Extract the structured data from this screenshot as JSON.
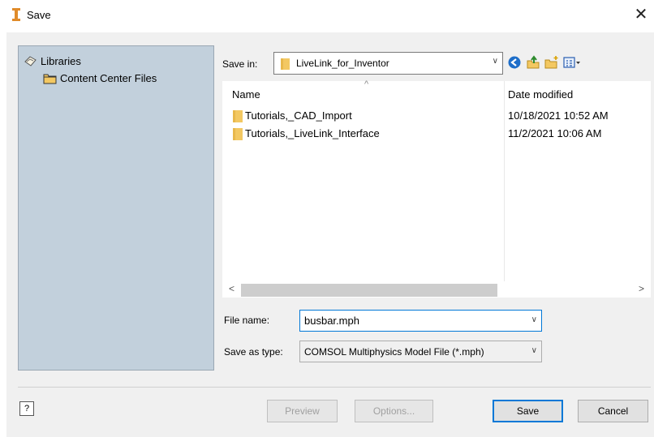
{
  "window": {
    "title": "Save",
    "close": "✕"
  },
  "places": {
    "items": [
      {
        "label": "Libraries",
        "icon": "libraries-icon"
      },
      {
        "label": "Content Center Files",
        "icon": "folder-icon"
      }
    ]
  },
  "save_in": {
    "label": "Save in:",
    "value": "LiveLink_for_Inventor"
  },
  "toolbar": {
    "icons": [
      "back-icon",
      "up-folder-icon",
      "new-folder-icon",
      "view-menu-icon"
    ]
  },
  "file_list": {
    "columns": {
      "name": "Name",
      "date": "Date modified"
    },
    "rows": [
      {
        "name": "Tutorials,_CAD_Import",
        "date": "10/18/2021 10:52 AM"
      },
      {
        "name": "Tutorials,_LiveLink_Interface",
        "date": "11/2/2021 10:06 AM"
      }
    ]
  },
  "file_name": {
    "label": "File name:",
    "value": "busbar.mph"
  },
  "save_as_type": {
    "label": "Save as type:",
    "value": "COMSOL Multiphysics Model File (*.mph)"
  },
  "buttons": {
    "preview": "Preview",
    "options": "Options...",
    "save": "Save",
    "cancel": "Cancel"
  },
  "colors": {
    "accent": "#0078d7",
    "places_bg": "#c2d0dc",
    "folder": "#f3c862"
  }
}
